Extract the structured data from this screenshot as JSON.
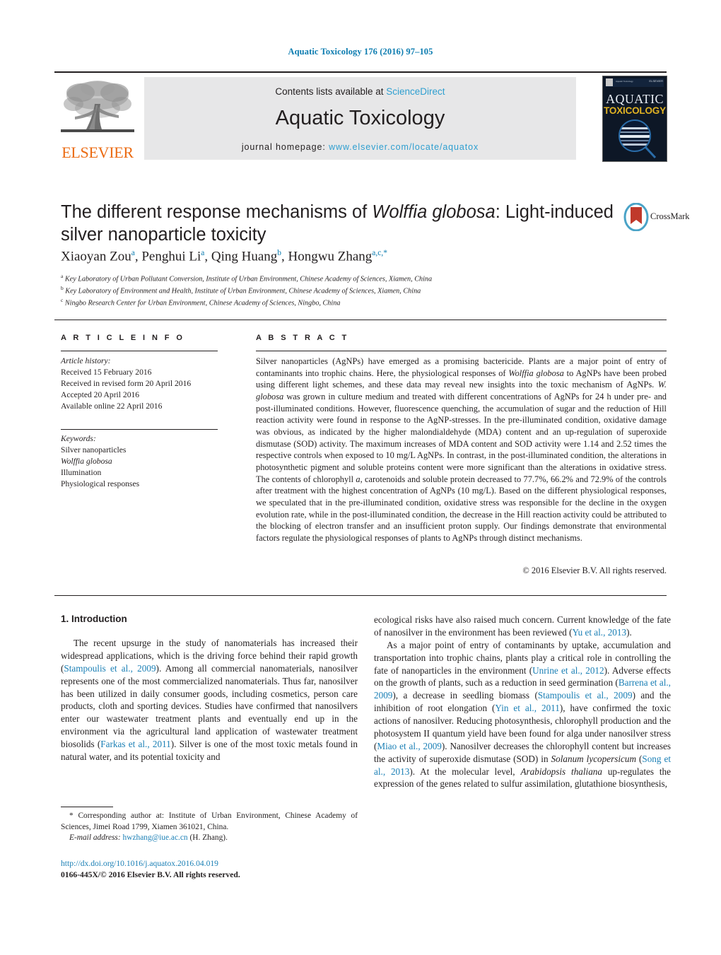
{
  "running_head": "Aquatic Toxicology 176 (2016) 97–105",
  "masthead": {
    "publisher_logo_text": "ELSEVIER",
    "contents_prefix": "Contents lists available at",
    "contents_link": "ScienceDirect",
    "journal_name": "Aquatic Toxicology",
    "homepage_label": "journal homepage:",
    "homepage_url": "www.elsevier.com/locate/aquatox",
    "cover": {
      "line1": "AQUATIC",
      "line2": "TOXICOLOGY",
      "masthead_small_left": "Aquatic Toxicology",
      "masthead_small_right": "ELSEVIER"
    }
  },
  "article": {
    "title_part1": "The different response mechanisms of ",
    "title_species": "Wolffia globosa",
    "title_part2": ": Light-induced silver nanoparticle toxicity",
    "crossmark_label": "CrossMark",
    "authors": [
      {
        "name": "Xiaoyan Zou",
        "sup": "a"
      },
      {
        "name": "Penghui Li",
        "sup": "a"
      },
      {
        "name": "Qing Huang",
        "sup": "b"
      },
      {
        "name": "Hongwu Zhang",
        "sup": "a,c,*"
      }
    ],
    "affiliations": [
      {
        "marker": "a",
        "text": "Key Laboratory of Urban Pollutant Conversion, Institute of Urban Environment, Chinese Academy of Sciences, Xiamen, China"
      },
      {
        "marker": "b",
        "text": "Key Laboratory of Environment and Health, Institute of Urban Environment, Chinese Academy of Sciences, Xiamen, China"
      },
      {
        "marker": "c",
        "text": "Ningbo Research Center for Urban Environment, Chinese Academy of Sciences, Ningbo, China"
      }
    ]
  },
  "article_info": {
    "heading": "A R T I C L E   I N F O",
    "history_label": "Article history:",
    "history": [
      "Received 15 February 2016",
      "Received in revised form 20 April 2016",
      "Accepted 20 April 2016",
      "Available online 22 April 2016"
    ],
    "keywords_label": "Keywords:",
    "keywords": [
      "Silver nanoparticles",
      "Wolffia globosa",
      "Illumination",
      "Physiological responses"
    ]
  },
  "abstract": {
    "heading": "A B S T R A C T",
    "p1_a": "Silver nanoparticles (AgNPs) have emerged as a promising bactericide. Plants are a major point of entry of contaminants into trophic chains. Here, the physiological responses of ",
    "p1_species1": "Wolffia globosa",
    "p1_b": " to AgNPs have been probed using different light schemes, and these data may reveal new insights into the toxic mechanism of AgNPs. ",
    "p1_species2": "W. globosa",
    "p1_c": " was grown in culture medium and treated with different concentrations of AgNPs for 24 h under pre- and post-illuminated conditions. However, fluorescence quenching, the accumulation of sugar and the reduction of Hill reaction activity were found in response to the AgNP-stresses. In the pre-illuminated condition, oxidative damage was obvious, as indicated by the higher malondialdehyde (MDA) content and an up-regulation of superoxide dismutase (SOD) activity. The maximum increases of MDA content and SOD activity were 1.14 and 2.52 times the respective controls when exposed to 10 mg/L AgNPs. In contrast, in the post-illuminated condition, the alterations in photosynthetic pigment and soluble proteins content were more significant than the alterations in oxidative stress. The contents of chlorophyll ",
    "p1_italic_a": "a",
    "p1_d": ", carotenoids and soluble protein decreased to 77.7%, 66.2% and 72.9% of the controls after treatment with the highest concentration of AgNPs (10 mg/L). Based on the different physiological responses, we speculated that in the pre-illuminated condition, oxidative stress was responsible for the decline in the oxygen evolution rate, while in the post-illuminated condition, the decrease in the Hill reaction activity could be attributed to the blocking of electron transfer and an insufficient proton supply. Our findings demonstrate that environmental factors regulate the physiological responses of plants to AgNPs through distinct mechanisms.",
    "copyright": "© 2016 Elsevier B.V. All rights reserved."
  },
  "body": {
    "section_heading": "1.  Introduction",
    "left_p1_a": "The recent upsurge in the study of nanomaterials has increased their widespread applications, which is the driving force behind their rapid growth (",
    "left_cite1": "Stampoulis et al., 2009",
    "left_p1_b": "). Among all commercial nanomaterials, nanosilver represents one of the most commercialized nanomaterials. Thus far, nanosilver has been utilized in daily consumer goods, including cosmetics, person care products, cloth and sporting devices. Studies have confirmed that nanosilvers enter our wastewater treatment plants and eventually end up in the environment via the agricultural land application of wastewater treatment biosolids (",
    "left_cite2": "Farkas et al., 2011",
    "left_p1_c": "). Silver is one of the most toxic metals found in natural water, and its potential toxicity and",
    "right_p1_a": "ecological risks have also raised much concern. Current knowledge of the fate of nanosilver in the environment has been reviewed (",
    "right_cite1": "Yu et al., 2013",
    "right_p1_b": ").",
    "right_p2_a": "As a major point of entry of contaminants by uptake, accumulation and transportation into trophic chains, plants play a critical role in controlling the fate of nanoparticles in the environment (",
    "right_cite2": "Unrine et al., 2012",
    "right_p2_b": "). Adverse effects on the growth of plants, such as a reduction in seed germination (",
    "right_cite3": "Barrena et al., 2009",
    "right_p2_c": "), a decrease in seedling biomass (",
    "right_cite4": "Stampoulis et al., 2009",
    "right_p2_d": ") and the inhibition of root elongation (",
    "right_cite5": "Yin et al., 2011",
    "right_p2_e": "), have confirmed the toxic actions of nanosilver. Reducing photosynthesis, chlorophyll production and the photosystem II quantum yield have been found for alga under nanosilver stress (",
    "right_cite6": "Miao et al., 2009",
    "right_p2_f": "). Nanosilver decreases the chlorophyll content but increases the activity of superoxide dismutase (SOD) in ",
    "right_species1": "Solanum lycopersicum",
    "right_p2_g": " (",
    "right_cite7": "Song et al., 2013",
    "right_p2_h": "). At the molecular level, ",
    "right_species2": "Arabidopsis thaliana",
    "right_p2_i": " up-regulates the expression of the genes related to sulfur assimilation, glutathione biosynthesis,"
  },
  "footer": {
    "corresponding_marker": "*",
    "corresponding_text": "Corresponding author at: Institute of Urban Environment, Chinese Academy of Sciences, Jimei Road 1799, Xiamen 361021, China.",
    "email_label": "E-mail address:",
    "email": "hwzhang@iue.ac.cn",
    "email_owner": "(H. Zhang).",
    "doi": "http://dx.doi.org/10.1016/j.aquatox.2016.04.019",
    "issn_line": "0166-445X/© 2016 Elsevier B.V. All rights reserved."
  },
  "colors": {
    "link_blue": "#1a7fb5",
    "sciencedirect_blue": "#2f9fd0",
    "elsevier_orange": "#eb6b13",
    "band_gray": "#e7e7e8"
  }
}
